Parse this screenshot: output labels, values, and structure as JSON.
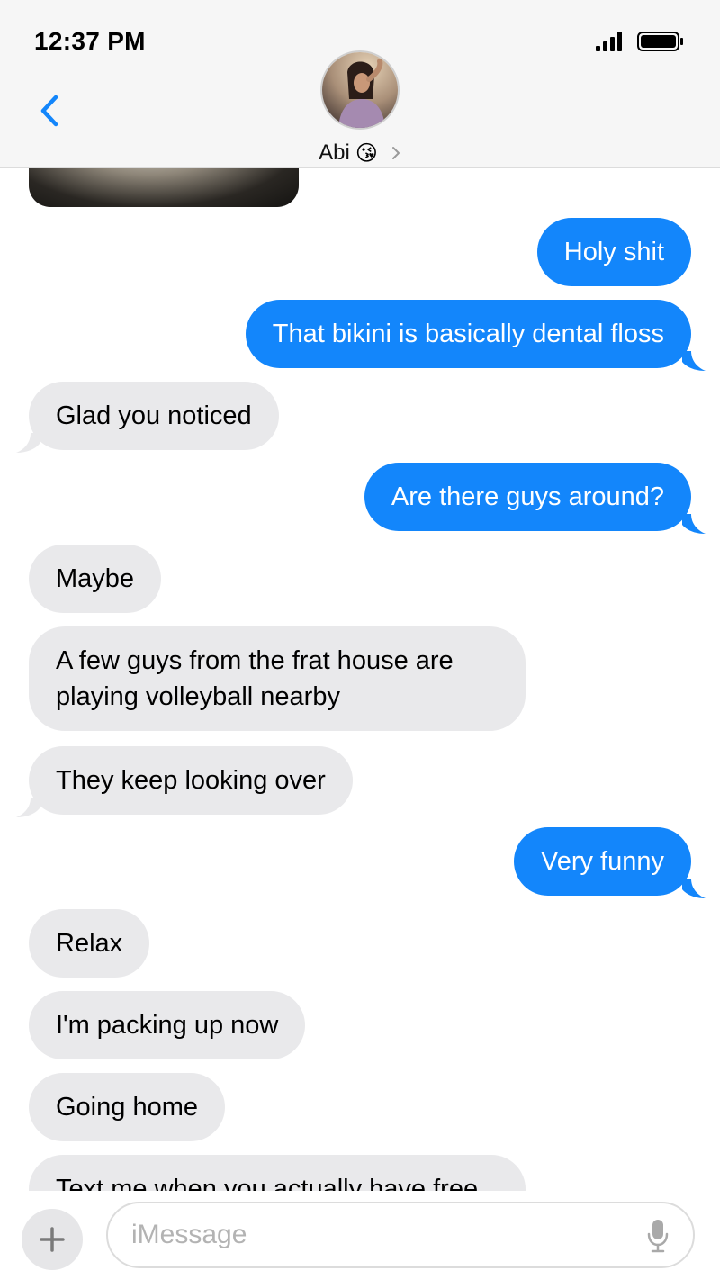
{
  "status_bar": {
    "time": "12:37 PM"
  },
  "header": {
    "contact_name": "Abi",
    "contact_emoji": "😘"
  },
  "messages": [
    {
      "direction": "out",
      "text": "Holy shit"
    },
    {
      "direction": "out",
      "text": "That bikini is basically dental floss"
    },
    {
      "direction": "in",
      "text": "Glad you noticed"
    },
    {
      "direction": "out",
      "text": "Are there guys around?"
    },
    {
      "direction": "in",
      "text": "Maybe"
    },
    {
      "direction": "in",
      "text": "A few guys from the frat house are playing volleyball nearby"
    },
    {
      "direction": "in",
      "text": "They keep looking over"
    },
    {
      "direction": "out",
      "text": "Very funny"
    },
    {
      "direction": "in",
      "text": "Relax"
    },
    {
      "direction": "in",
      "text": "I'm packing up now"
    },
    {
      "direction": "in",
      "text": "Going home"
    },
    {
      "direction": "in",
      "text": "Text me when you actually have free"
    }
  ],
  "composer": {
    "placeholder": "iMessage",
    "value": ""
  },
  "colors": {
    "outgoing": "#1386fb",
    "incoming": "#e9e9eb",
    "accent": "#1386fb"
  },
  "icons": [
    "back-chevron-icon",
    "video-call-icon",
    "signal-icon",
    "battery-icon",
    "plus-icon",
    "microphone-icon"
  ]
}
